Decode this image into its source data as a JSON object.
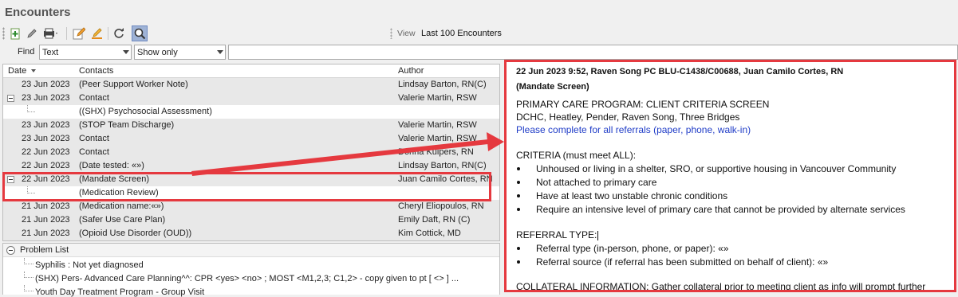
{
  "window": {
    "title": "Encounters"
  },
  "toolbar": {
    "view_label": "View",
    "view_value": "Last 100 Encounters",
    "icons": [
      "add-icon",
      "pencil-icon",
      "print-icon",
      "edit-note-icon",
      "highlight-icon",
      "refresh-icon",
      "search-record-icon"
    ]
  },
  "find": {
    "label": "Find",
    "field_value": "Text",
    "mode_value": "Show only",
    "query": ""
  },
  "encounters": {
    "columns": {
      "date": "Date",
      "contacts": "Contacts",
      "author": "Author"
    },
    "rows": [
      {
        "date": "23 Jun 2023",
        "contact": "(Peer Support Worker Note)",
        "author": "Lindsay Barton, RN(C)"
      },
      {
        "date": "23 Jun 2023",
        "contact": "Contact",
        "author": "Valerie Martin, RSW"
      },
      {
        "date": "",
        "contact": "((SHX) Psychosocial Assessment)",
        "author": ""
      },
      {
        "date": "23 Jun 2023",
        "contact": "(STOP Team Discharge)",
        "author": "Valerie Martin, RSW"
      },
      {
        "date": "23 Jun 2023",
        "contact": "Contact",
        "author": "Valerie Martin, RSW"
      },
      {
        "date": "22 Jun 2023",
        "contact": "Contact",
        "author": "Donna Kuipers, RN"
      },
      {
        "date": "22 Jun 2023",
        "contact": "(Date tested: «»)",
        "author": "Lindsay Barton, RN(C)"
      },
      {
        "date": "22 Jun 2023",
        "contact": "(Mandate Screen)",
        "author": "Juan Camilo Cortes, RN"
      },
      {
        "date": "",
        "contact": "(Medication Review)",
        "author": ""
      },
      {
        "date": "21 Jun 2023",
        "contact": "(Medication name:«»)",
        "author": "Cheryl Eliopoulos, RN"
      },
      {
        "date": "21 Jun 2023",
        "contact": "(Safer Use Care Plan)",
        "author": "Emily Daft, RN (C)"
      },
      {
        "date": "21 Jun 2023",
        "contact": "(Opioid Use Disorder (OUD))",
        "author": "Kim Cottick, MD"
      }
    ]
  },
  "problem_list": {
    "title": "Problem List",
    "items": [
      "Syphilis : Not yet diagnosed",
      "(SHX) Pers- Advanced Care Planning^^: CPR <yes> <no> ; MOST <M1,2,3; C1,2> - copy given to pt [ <> ] ...",
      "Youth Day Treatment Program - Group Visit"
    ]
  },
  "detail": {
    "header": "22 Jun 2023 9:52, Raven Song PC BLU-C1438/C00688, Juan Camilo Cortes, RN",
    "subheader": "(Mandate Screen)",
    "program_title": "PRIMARY CARE PROGRAM: CLIENT CRITERIA SCREEN",
    "locations": "DCHC, Heatley, Pender, Raven Song, Three Bridges",
    "instruction": "Please complete for all referrals (paper, phone, walk-in)",
    "criteria_title": "CRITERIA (must meet ALL):",
    "criteria": [
      "Unhoused or living in a shelter, SRO, or supportive housing in Vancouver Community",
      "Not attached to primary care",
      "Have at least two unstable chronic conditions",
      "Require an intensive level of primary care that cannot be provided by alternate services"
    ],
    "referral_title": "REFERRAL TYPE:",
    "referral_items": [
      "Referral type (in-person, phone, or paper): «»",
      "Referral source (if referral has been submitted on behalf of client): «»"
    ],
    "collateral": "COLLATERAL INFORMATION: Gather collateral prior to meeting client as info will prompt further"
  },
  "colors": {
    "annotation": "#e5393f",
    "link": "#1f3cc7",
    "row_bg": "#e8e8e8"
  }
}
